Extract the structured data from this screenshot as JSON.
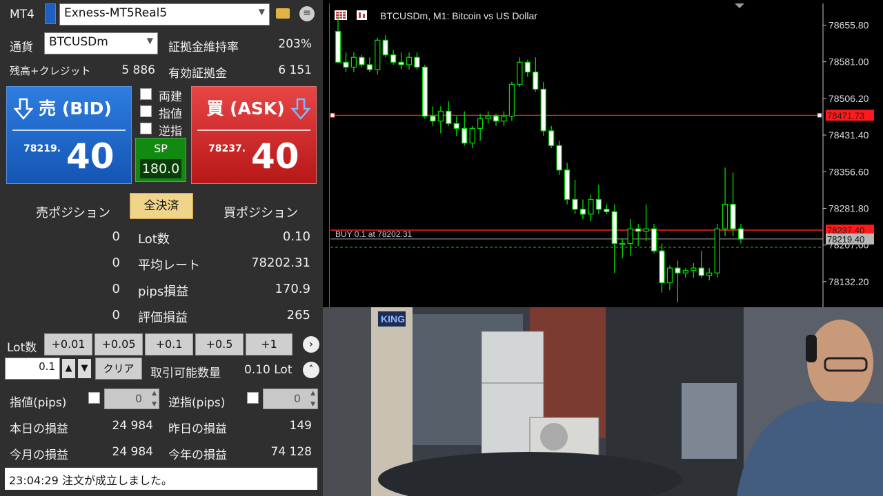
{
  "header": {
    "platform": "MT4",
    "account": "Exness-MT5Real5"
  },
  "info": {
    "currency_label": "通貨",
    "symbol": "BTCUSDm",
    "margin_level_label": "証拠金維持率",
    "margin_level_value": "203%",
    "balance_label": "残高+クレジット",
    "balance_value": "5 886",
    "equity_label": "有効証拠金",
    "equity_value": "6 151"
  },
  "sell": {
    "label": "売 (BID)",
    "price_prefix": "78219.",
    "price_big": "40"
  },
  "buy": {
    "label": "買 (ASK)",
    "price_prefix": "78237.",
    "price_big": "40"
  },
  "options": {
    "hedge": "両建",
    "limit": "指値",
    "stop": "逆指"
  },
  "spread": {
    "label": "SP",
    "value": "180.0"
  },
  "positions": {
    "sell_title": "売ポジション",
    "close_all": "全決済",
    "buy_title": "買ポジション",
    "rows": [
      {
        "sell": "0",
        "label": "Lot数",
        "buy": "0.10"
      },
      {
        "sell": "0",
        "label": "平均レート",
        "buy": "78202.31"
      },
      {
        "sell": "0",
        "label": "pips損益",
        "buy": "170.9"
      },
      {
        "sell": "0",
        "label": "評価損益",
        "buy": "265"
      }
    ]
  },
  "lot": {
    "label": "Lot数",
    "buttons": [
      "+0.01",
      "+0.05",
      "+0.1",
      "+0.5",
      "+1"
    ],
    "input_value": "0.1",
    "up": "▲",
    "down": "▼",
    "clear": "クリア",
    "tradable_label": "取引可能数量",
    "tradable_value": "0.10 Lot"
  },
  "pips": {
    "limit_label": "指値(pips)",
    "limit_value": "0",
    "stop_label": "逆指(pips)",
    "stop_value": "0"
  },
  "pnl": {
    "today_label": "本日の損益",
    "today_value": "24 984",
    "yesterday_label": "昨日の損益",
    "yesterday_value": "149",
    "month_label": "今月の損益",
    "month_value": "24 984",
    "year_label": "今年の損益",
    "year_value": "74 128"
  },
  "status": "23:04:29 注文が成立しました。",
  "chart_data": {
    "type": "candlestick",
    "title": "BTCUSDm, M1:  Bitcoin vs US Dollar",
    "y_ticks": [
      "78655.80",
      "78581.00",
      "78506.20",
      "78431.40",
      "78356.60",
      "78281.80",
      "78207.00",
      "78132.20"
    ],
    "ylim": [
      78080,
      78700
    ],
    "bullish_color": "#00e000",
    "bearish_color": "#00e000",
    "candles": [
      [
        78643,
        78670,
        78580,
        78580
      ],
      [
        78580,
        78600,
        78560,
        78570
      ],
      [
        78570,
        78600,
        78560,
        78590
      ],
      [
        78590,
        78595,
        78570,
        78575
      ],
      [
        78575,
        78590,
        78560,
        78565
      ],
      [
        78565,
        78630,
        78555,
        78625
      ],
      [
        78625,
        78635,
        78590,
        78595
      ],
      [
        78595,
        78605,
        78575,
        78580
      ],
      [
        78580,
        78600,
        78565,
        78575
      ],
      [
        78575,
        78600,
        78565,
        78590
      ],
      [
        78590,
        78600,
        78565,
        78570
      ],
      [
        78570,
        78575,
        78465,
        78470
      ],
      [
        78470,
        78490,
        78450,
        78460
      ],
      [
        78460,
        78490,
        78435,
        78480
      ],
      [
        78480,
        78500,
        78450,
        78455
      ],
      [
        78455,
        78470,
        78430,
        78445
      ],
      [
        78445,
        78480,
        78410,
        78415
      ],
      [
        78415,
        78450,
        78405,
        78445
      ],
      [
        78445,
        78475,
        78420,
        78465
      ],
      [
        78465,
        78480,
        78455,
        78470
      ],
      [
        78470,
        78475,
        78450,
        78460
      ],
      [
        78460,
        78480,
        78450,
        78470
      ],
      [
        78470,
        78540,
        78460,
        78535
      ],
      [
        78535,
        78590,
        78530,
        78580
      ],
      [
        78580,
        78585,
        78550,
        78560
      ],
      [
        78560,
        78590,
        78520,
        78525
      ],
      [
        78525,
        78540,
        78430,
        78440
      ],
      [
        78440,
        78450,
        78405,
        78410
      ],
      [
        78410,
        78420,
        78350,
        78360
      ],
      [
        78360,
        78375,
        78290,
        78300
      ],
      [
        78300,
        78340,
        78270,
        78280
      ],
      [
        78280,
        78300,
        78260,
        78270
      ],
      [
        78270,
        78310,
        78255,
        78300
      ],
      [
        78300,
        78330,
        78270,
        78280
      ],
      [
        78280,
        78290,
        78270,
        78275
      ],
      [
        78275,
        78290,
        78150,
        78210
      ],
      [
        78210,
        78220,
        78180,
        78210
      ],
      [
        78210,
        78260,
        78185,
        78240
      ],
      [
        78240,
        78250,
        78205,
        78235
      ],
      [
        78235,
        78290,
        78215,
        78240
      ],
      [
        78240,
        78250,
        78190,
        78195
      ],
      [
        78195,
        78210,
        78110,
        78130
      ],
      [
        78130,
        78165,
        78115,
        78160
      ],
      [
        78160,
        78175,
        78090,
        78150
      ],
      [
        78150,
        78160,
        78140,
        78155
      ],
      [
        78155,
        78170,
        78140,
        78160
      ],
      [
        78160,
        78195,
        78140,
        78145
      ],
      [
        78145,
        78160,
        78135,
        78150
      ],
      [
        78150,
        78250,
        78140,
        78240
      ],
      [
        78240,
        78365,
        78225,
        78290
      ],
      [
        78290,
        78355,
        78225,
        78240
      ],
      [
        78240,
        78250,
        78210,
        78219
      ]
    ],
    "bid_price": "78219.40",
    "ask_price": "78237.40",
    "red_level_price": "78471.73",
    "position_label": "BUY 0.1 at 78202.31",
    "position_price": 78202.31
  }
}
